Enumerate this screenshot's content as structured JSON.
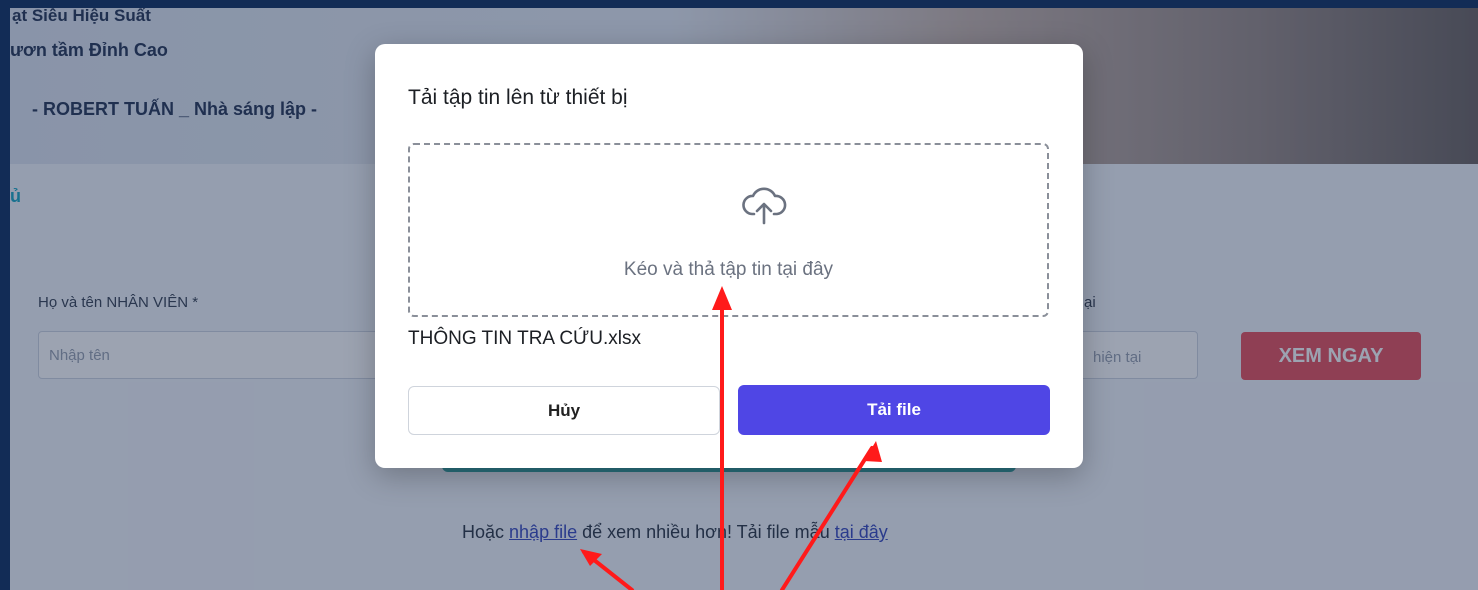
{
  "background_page": {
    "hero": {
      "line1": "ạt Siêu Hiệu Suất",
      "line2": "ươn tầm Đỉnh Cao",
      "line3": "- ROBERT TUẤN _ Nhà sáng lập -"
    },
    "teal_fragment": "ủ",
    "form": {
      "name_label": "Họ và tên NHÂN VIÊN *",
      "name_placeholder": "Nhập tên",
      "right_label": "ại",
      "right_placeholder": "hiện tại",
      "view_button": "XEM NGAY"
    },
    "bottom": {
      "prefix": "Hoặc ",
      "link_import": "nhập file",
      "middle": " để xem nhiều hơn! Tải file mẫu ",
      "link_here": "tại đây"
    }
  },
  "modal": {
    "title": "Tải tập tin lên từ thiết bị",
    "dropzone_text": "Kéo và thả tập tin tại đây",
    "dropzone_icon": "cloud-upload-icon",
    "selected_file": "THÔNG TIN TRA CỨU.xlsx",
    "cancel_label": "Hủy",
    "upload_label": "Tải file"
  },
  "colors": {
    "primary": "#4f46e5",
    "view_button": "#e8535f",
    "annotation_arrow": "#ff0000",
    "link": "#3b4cc0"
  }
}
